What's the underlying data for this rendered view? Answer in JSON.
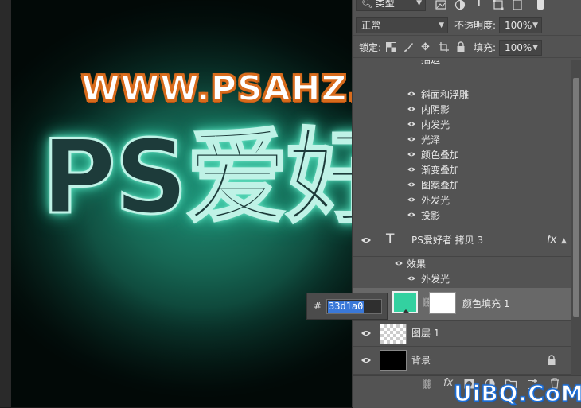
{
  "canvas": {
    "artwork_text": "PS爱好",
    "watermark_top": "WWW.PSAHZ.COM"
  },
  "panel": {
    "filter_kind": "类型",
    "blend_mode": "正常",
    "opacity_label": "不透明度:",
    "opacity_value": "100%",
    "lock_label": "锁定:",
    "fill_label": "填充:",
    "fill_value": "100%",
    "partial_effect_top": "描边",
    "effects_group1": [
      "斜面和浮雕",
      "内阴影",
      "内发光",
      "光泽",
      "颜色叠加",
      "渐变叠加",
      "图案叠加",
      "外发光",
      "投影"
    ],
    "layers": [
      {
        "name": "PS爱好者 拷贝 3",
        "type": "text",
        "fx": "fx"
      },
      {
        "name": "颜色填充 1",
        "type": "fill",
        "selected": true
      },
      {
        "name": "图层 1",
        "type": "pixel"
      },
      {
        "name": "背景",
        "type": "background",
        "locked": true
      }
    ],
    "effects_label": "效果",
    "effects_group2": [
      "外发光"
    ],
    "text_layer_icon": "T"
  },
  "hex_popup": {
    "hash": "#",
    "value": "33d1a0"
  },
  "colors": {
    "fill_swatch": "#33d1a0",
    "panel_bg": "#535353",
    "selected_row": "#686868"
  },
  "bottom_watermark": "UiBQ.CoM"
}
